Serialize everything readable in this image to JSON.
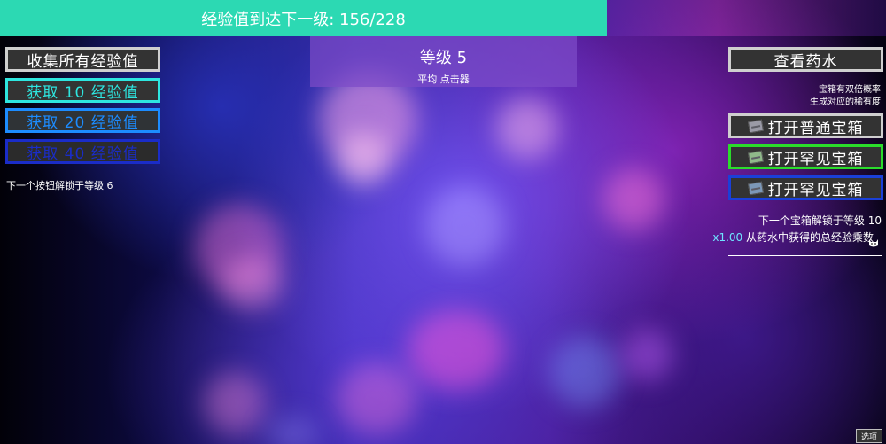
{
  "header": {
    "progress_text": "经验值到达下一级: 156/228",
    "xp_current": 156,
    "xp_target": 228
  },
  "level_panel": {
    "title": "等级 5",
    "subtitle": "平均 点击器"
  },
  "left": {
    "collect_all_label": "收集所有经验值",
    "get_10_label": "获取 10 经验值",
    "get_20_label": "获取 20 经验值",
    "get_40_label": "获取 40 经验值",
    "unlock_note": "下一个按钮解锁于等级 6"
  },
  "right": {
    "potion_label": "查看药水",
    "chest_note_line1": "宝箱有双倍概率",
    "chest_note_line2": "生成对应的稀有度",
    "open_common_label": "打开普通宝箱",
    "open_rare_label_1": "打开罕见宝箱",
    "open_rare_label_2": "打开罕见宝箱",
    "chest_unlock_note": "下一个宝箱解锁于等级 10",
    "multiplier_value": "x1.00",
    "multiplier_text": " 从药水中获得的总经验乘数"
  },
  "footer": {
    "options_label": "选项"
  },
  "colors": {
    "header_bar": "#2cd9b3",
    "cyan_border": "#2ee6e0",
    "blue_border": "#1c8cff",
    "dark_blue_border": "#1a2cc8",
    "green_border": "#2bdc2b",
    "grey_border": "#cfcfcf"
  },
  "icons": [
    "chest-icon",
    "cat-icon"
  ]
}
